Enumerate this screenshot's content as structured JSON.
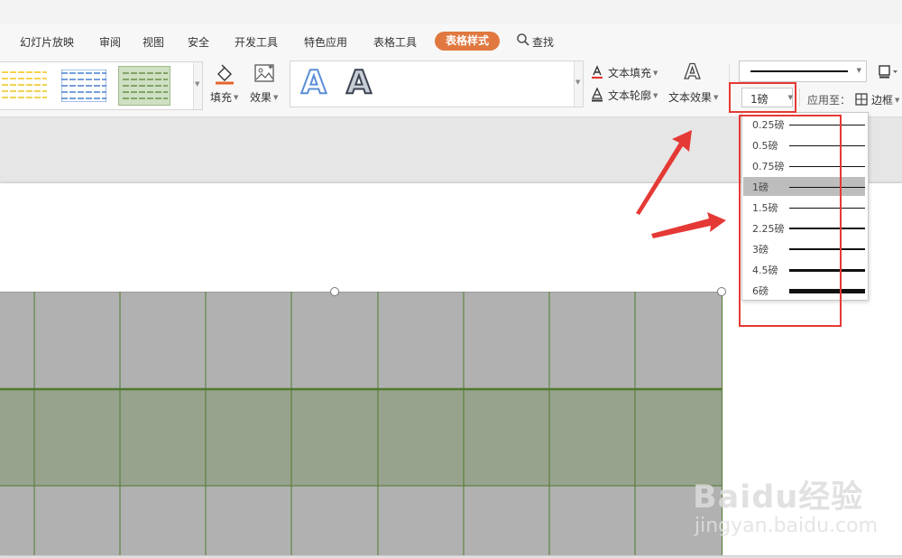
{
  "menu": {
    "items": [
      {
        "label": "幻灯片放映"
      },
      {
        "label": "审阅"
      },
      {
        "label": "视图"
      },
      {
        "label": "安全"
      },
      {
        "label": "开发工具"
      },
      {
        "label": "特色应用"
      },
      {
        "label": "表格工具"
      },
      {
        "label": "表格样式",
        "active": true
      }
    ],
    "search_label": "查找"
  },
  "ribbon": {
    "fill_label": "填充",
    "effect_label": "效果",
    "text_fill_label": "文本填充",
    "text_outline_label": "文本轮廓",
    "text_effect_label": "文本效果",
    "text_effect_icon_letter": "A",
    "art_letter_1": "A",
    "art_letter_2": "A",
    "line_weight_value": "1磅",
    "apply_to_label": "应用至：",
    "border_label": "边框"
  },
  "line_weight_options": [
    {
      "label": "0.25磅",
      "weight_pt": 0.25
    },
    {
      "label": "0.5磅",
      "weight_pt": 0.5
    },
    {
      "label": "0.75磅",
      "weight_pt": 0.75
    },
    {
      "label": "1磅",
      "weight_pt": 1,
      "selected": true
    },
    {
      "label": "1.5磅",
      "weight_pt": 1.5
    },
    {
      "label": "2.25磅",
      "weight_pt": 2.25
    },
    {
      "label": "3磅",
      "weight_pt": 3
    },
    {
      "label": "4.5磅",
      "weight_pt": 4.5
    },
    {
      "label": "6磅",
      "weight_pt": 6
    }
  ],
  "table_style_thumbs": [
    {
      "color": "#f0c419",
      "selected": false
    },
    {
      "color": "#4a7fd0",
      "selected": false
    },
    {
      "color": "#7aa35a",
      "selected": true
    }
  ],
  "table": {
    "border_color": "#4f7a2e",
    "band_color": "#98a38e",
    "base_color": "#b1b1b1"
  },
  "watermark": {
    "logo": "Baidu经验",
    "url": "jingyan.baidu.com"
  }
}
